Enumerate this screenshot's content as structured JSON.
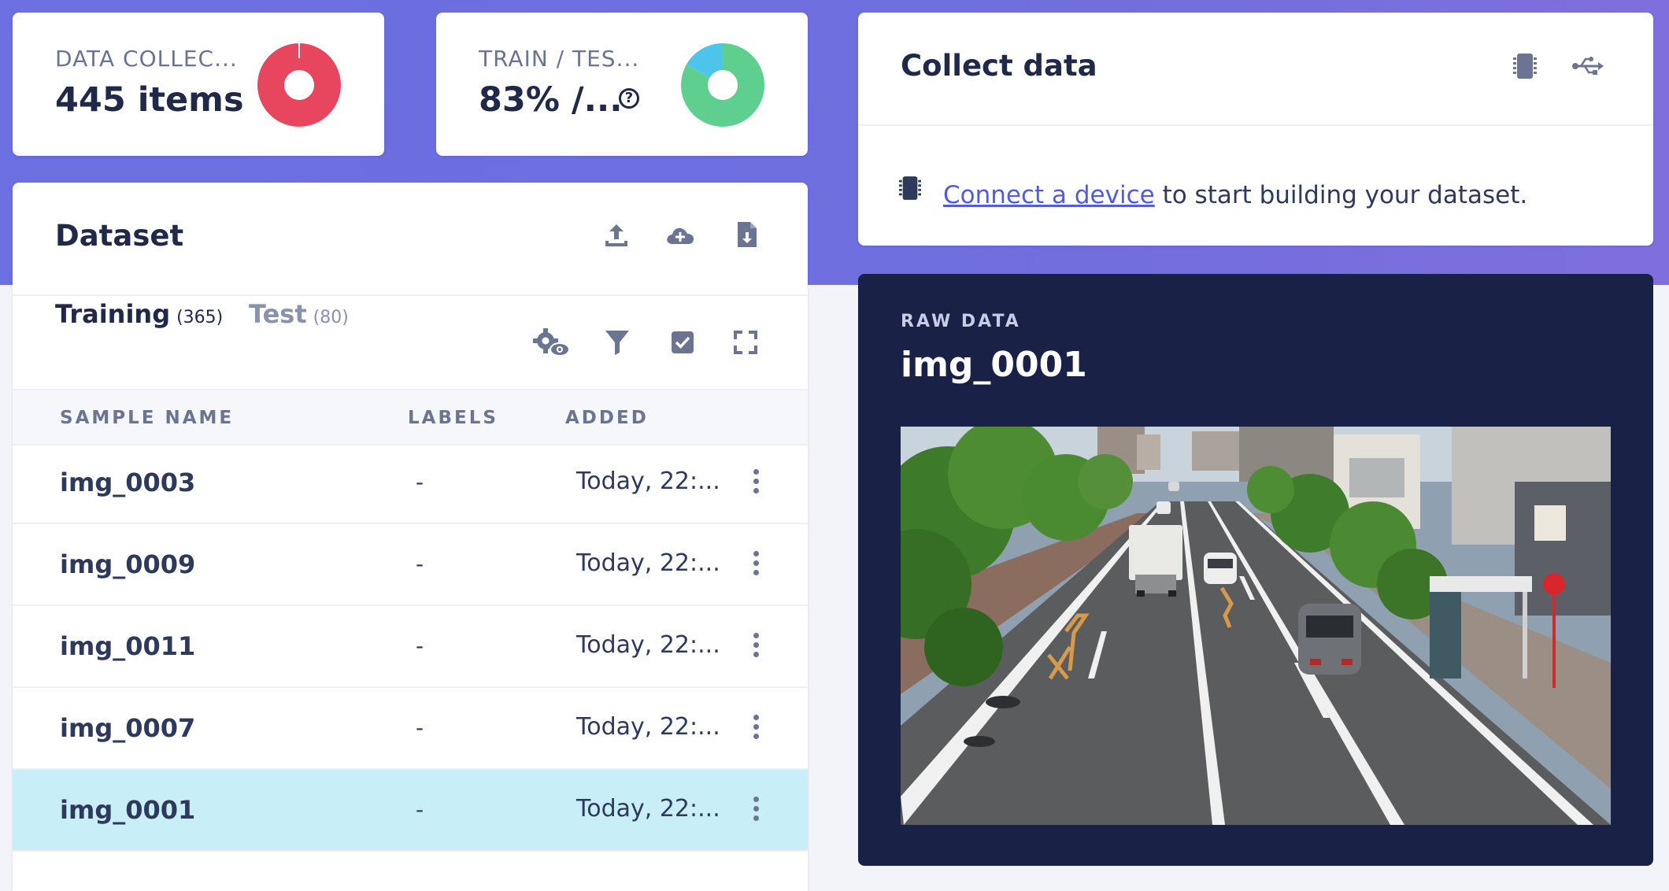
{
  "colors": {
    "accent": "#6b6fe0",
    "link": "#4f5ce0",
    "navy_panel": "#1a2147",
    "selected_row": "#c8eef8",
    "donut_red": "#e8455f",
    "donut_green": "#5fcf8f",
    "donut_blue": "#4dc4ea"
  },
  "stats": {
    "data_collected": {
      "label": "DATA COLLEC...",
      "value": "445 items"
    },
    "train_test": {
      "label": "TRAIN / TES...",
      "value": "83% /...",
      "help_icon": "question-icon",
      "train_percent": 83
    }
  },
  "dataset": {
    "title": "Dataset",
    "actions": [
      "upload-icon",
      "cloud-add-icon",
      "file-download-icon"
    ],
    "tabs": [
      {
        "label": "Training",
        "count": "(365)"
      },
      {
        "label": "Test",
        "count": "(80)"
      }
    ],
    "tools": [
      "settings-eye-icon",
      "filter-icon",
      "checkbox-icon",
      "expand-icon"
    ],
    "columns": [
      "SAMPLE NAME",
      "LABELS",
      "ADDED"
    ],
    "rows": [
      {
        "name": "img_0003",
        "labels": "-",
        "added": "Today, 22:..."
      },
      {
        "name": "img_0009",
        "labels": "-",
        "added": "Today, 22:..."
      },
      {
        "name": "img_0011",
        "labels": "-",
        "added": "Today, 22:..."
      },
      {
        "name": "img_0007",
        "labels": "-",
        "added": "Today, 22:..."
      },
      {
        "name": "img_0001",
        "labels": "-",
        "added": "Today, 22:...",
        "selected": true
      }
    ]
  },
  "collect": {
    "title": "Collect data",
    "icons": [
      "device-chip-icon",
      "usb-icon"
    ],
    "link_text": "Connect a device",
    "rest_text": " to start building your dataset."
  },
  "raw": {
    "label": "RAW DATA",
    "title": "img_0001",
    "image_alt": "street scene with vehicles"
  }
}
